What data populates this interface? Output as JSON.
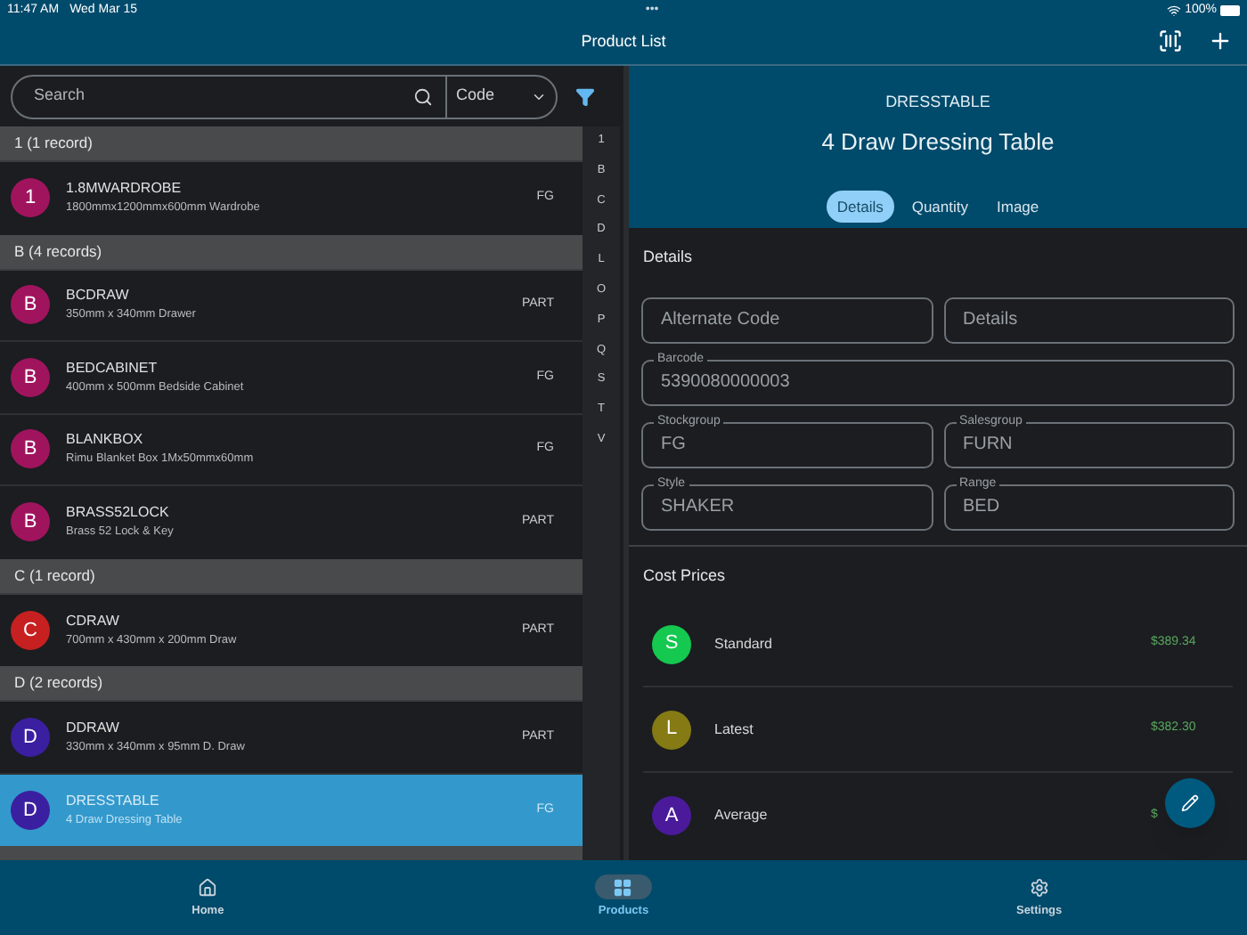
{
  "status_bar": {
    "time": "11:47 AM",
    "date": "Wed Mar 15",
    "more": "•••",
    "battery": "100%"
  },
  "header": {
    "title": "Product List"
  },
  "search": {
    "placeholder": "Search",
    "field_select": "Code"
  },
  "sections": [
    {
      "title": "1 (1 record)",
      "items": [
        {
          "initial": "1",
          "code": "1.8MWARDROBE",
          "description": "1800mmx1200mmx600mm Wardrobe",
          "group": "FG",
          "color": "#a0145e",
          "selected": false
        }
      ]
    },
    {
      "title": "B (4 records)",
      "items": [
        {
          "initial": "B",
          "code": "BCDRAW",
          "description": "350mm x 340mm Drawer",
          "group": "PART",
          "color": "#a0145e",
          "selected": false
        },
        {
          "initial": "B",
          "code": "BEDCABINET",
          "description": "400mm x 500mm Bedside Cabinet",
          "group": "FG",
          "color": "#a0145e",
          "selected": false
        },
        {
          "initial": "B",
          "code": "BLANKBOX",
          "description": "Rimu Blanket Box 1Mx50mmx60mm",
          "group": "FG",
          "color": "#a0145e",
          "selected": false
        },
        {
          "initial": "B",
          "code": "BRASS52LOCK",
          "description": "Brass 52 Lock & Key",
          "group": "PART",
          "color": "#a0145e",
          "selected": false
        }
      ]
    },
    {
      "title": "C (1 record)",
      "items": [
        {
          "initial": "C",
          "code": "CDRAW",
          "description": "700mm x 430mm x 200mm Draw",
          "group": "PART",
          "color": "#c62020",
          "selected": false
        }
      ]
    },
    {
      "title": "D (2 records)",
      "items": [
        {
          "initial": "D",
          "code": "DDRAW",
          "description": "330mm x 340mm x 95mm D. Draw",
          "group": "PART",
          "color": "#3a1fa0",
          "selected": false
        },
        {
          "initial": "D",
          "code": "DRESSTABLE",
          "description": "4 Draw Dressing Table",
          "group": "FG",
          "color": "#3a1fa0",
          "selected": true
        }
      ]
    }
  ],
  "index_letters": [
    "1",
    "B",
    "C",
    "D",
    "L",
    "O",
    "P",
    "Q",
    "S",
    "T",
    "V"
  ],
  "detail": {
    "code": "DRESSTABLE",
    "name": "4 Draw Dressing Table",
    "tabs": [
      {
        "label": "Details",
        "selected": true
      },
      {
        "label": "Quantity",
        "selected": false
      },
      {
        "label": "Image",
        "selected": false
      }
    ],
    "details_title": "Details",
    "fields": [
      {
        "placeholder": "Alternate Code"
      },
      {
        "placeholder": "Details"
      },
      {
        "label": "Barcode",
        "value": "5390080000003",
        "wide": true
      },
      {
        "label": "Stockgroup",
        "value": "FG"
      },
      {
        "label": "Salesgroup",
        "value": "FURN"
      },
      {
        "label": "Style",
        "value": "SHAKER"
      },
      {
        "label": "Range",
        "value": "BED"
      }
    ],
    "cost_title": "Cost Prices",
    "costs": [
      {
        "initial": "S",
        "name": "Standard",
        "value": "$389.34",
        "color": "#14c850"
      },
      {
        "initial": "L",
        "name": "Latest",
        "value": "$382.30",
        "color": "#857a14"
      },
      {
        "initial": "A",
        "name": "Average",
        "value": "$",
        "color": "#4a1a9a"
      }
    ]
  },
  "nav": [
    {
      "label": "Home",
      "selected": false
    },
    {
      "label": "Products",
      "selected": true
    },
    {
      "label": "Settings",
      "selected": false
    }
  ]
}
